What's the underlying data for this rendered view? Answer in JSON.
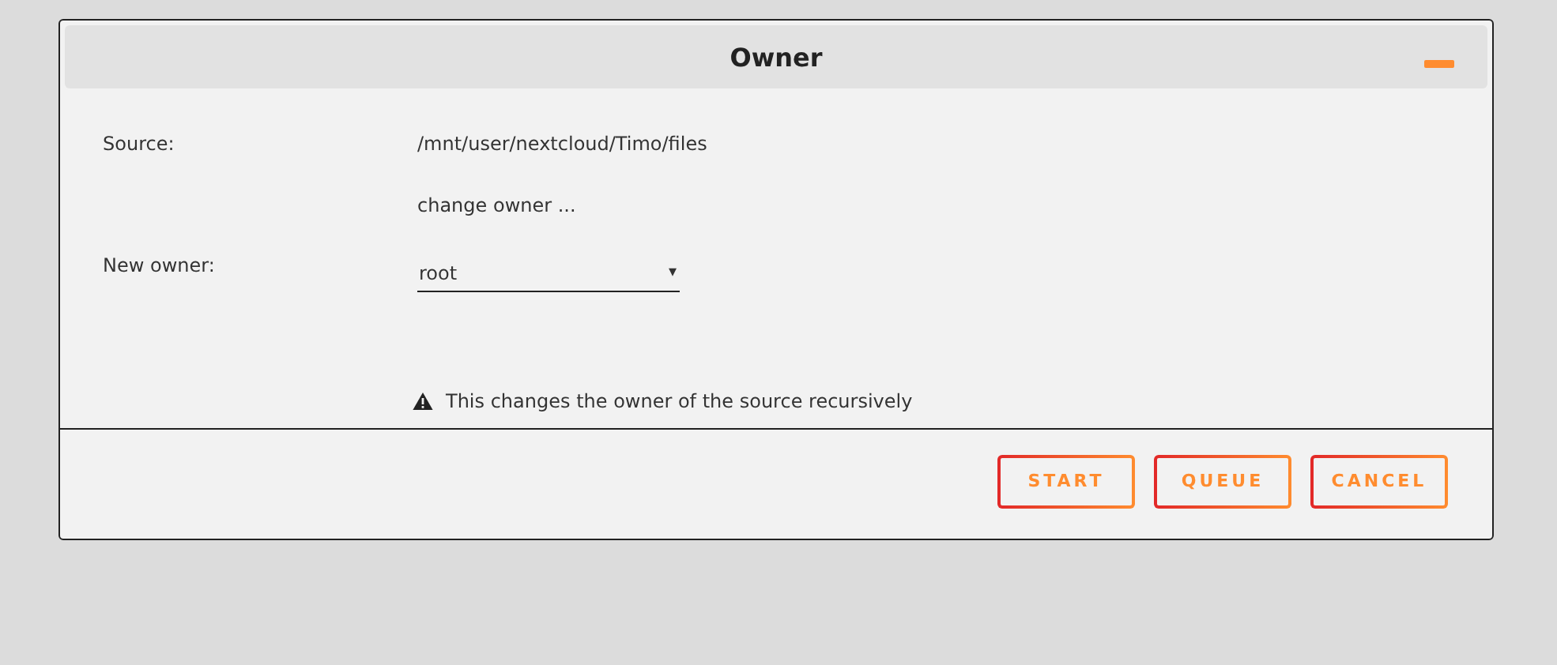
{
  "dialog": {
    "title": "Owner"
  },
  "fields": [
    {
      "kind": "text",
      "label": "Source:",
      "value": "/mnt/user/nextcloud/Timo/files"
    },
    {
      "kind": "text",
      "value": "change owner ..."
    },
    {
      "kind": "select",
      "label": "New owner:",
      "value": "root",
      "arrow": "▾"
    }
  ],
  "warning": "This changes the owner of the source recursively",
  "buttons": [
    "START",
    "QUEUE",
    "CANCEL"
  ]
}
